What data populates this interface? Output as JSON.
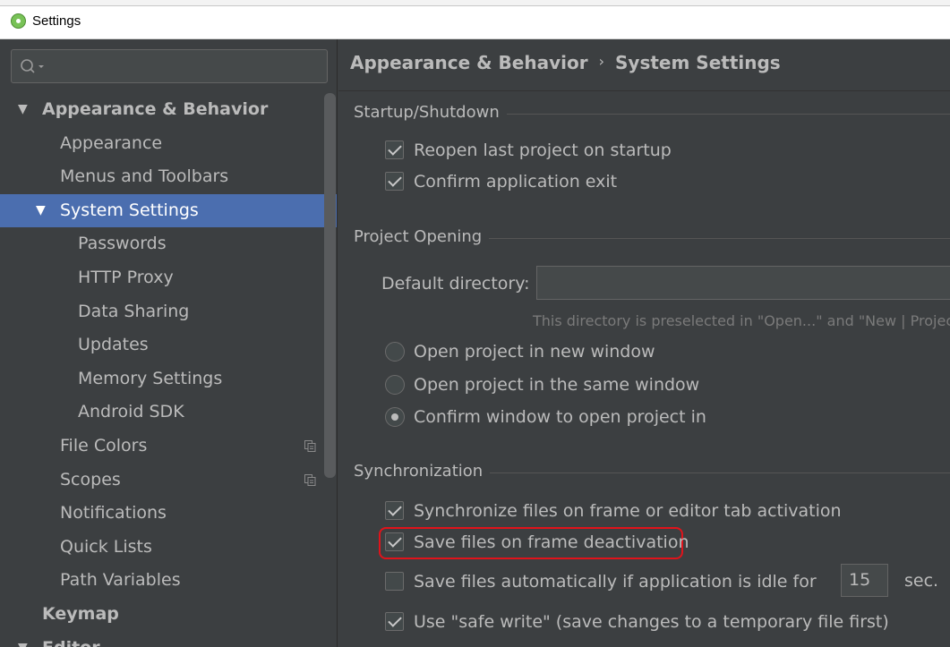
{
  "window": {
    "title": "Settings"
  },
  "sidebar": {
    "search": {
      "placeholder": ""
    },
    "tree": [
      {
        "label": "Appearance & Behavior",
        "level": 0,
        "expanded": true,
        "bold": true
      },
      {
        "label": "Appearance",
        "level": 1
      },
      {
        "label": "Menus and Toolbars",
        "level": 1
      },
      {
        "label": "System Settings",
        "level": 1,
        "expanded": true,
        "selected": true
      },
      {
        "label": "Passwords",
        "level": 2
      },
      {
        "label": "HTTP Proxy",
        "level": 2
      },
      {
        "label": "Data Sharing",
        "level": 2
      },
      {
        "label": "Updates",
        "level": 2
      },
      {
        "label": "Memory Settings",
        "level": 2
      },
      {
        "label": "Android SDK",
        "level": 2
      },
      {
        "label": "File Colors",
        "level": 1,
        "project_icon": "copy-icon"
      },
      {
        "label": "Scopes",
        "level": 1,
        "project_icon": "copy-icon"
      },
      {
        "label": "Notifications",
        "level": 1
      },
      {
        "label": "Quick Lists",
        "level": 1
      },
      {
        "label": "Path Variables",
        "level": 1
      },
      {
        "label": "Keymap",
        "level": 0,
        "bold": true
      },
      {
        "label": "Editor",
        "level": 0,
        "expanded": true,
        "bold": true
      }
    ]
  },
  "main": {
    "breadcrumb": {
      "parent": "Appearance & Behavior",
      "separator": "›",
      "current": "System Settings"
    },
    "startup": {
      "title": "Startup/Shutdown",
      "reopen_last": {
        "label": "Reopen last project on startup",
        "checked": true
      },
      "confirm_exit": {
        "label": "Confirm application exit",
        "checked": true
      }
    },
    "project_opening": {
      "title": "Project Opening",
      "default_directory": {
        "label": "Default directory:",
        "value": ""
      },
      "hint": "This directory is preselected in \"Open...\" and \"New | Project...",
      "new_window": {
        "label": "Open project in new window",
        "selected": false
      },
      "same_window": {
        "label": "Open project in the same window",
        "selected": false
      },
      "confirm_window": {
        "label": "Confirm window to open project in",
        "selected": true
      }
    },
    "synchronization": {
      "title": "Synchronization",
      "sync_on_activation": {
        "label": "Synchronize files on frame or editor tab activation",
        "checked": true
      },
      "save_on_deactivation": {
        "label": "Save files on frame deactivation",
        "checked": true
      },
      "save_when_idle": {
        "label": "Save files automatically if application is idle for",
        "checked": false,
        "seconds": "15",
        "unit": "sec."
      },
      "safe_write": {
        "label": "Use \"safe write\" (save changes to a temporary file first)",
        "checked": true
      }
    }
  },
  "colors": {
    "background": "#3c3f41",
    "selection": "#4b6eaf",
    "text": "#bbbbbb",
    "highlight_annotation": "#e0131b"
  }
}
